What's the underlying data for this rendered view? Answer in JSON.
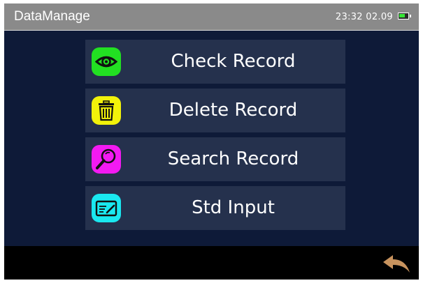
{
  "header": {
    "title": "DataManage",
    "datetime": "23:32  02.09",
    "battery_icon": "battery-icon"
  },
  "menu": [
    {
      "label": "Check Record",
      "icon": "eye-icon",
      "icon_bg": "#22e022"
    },
    {
      "label": "Delete Record",
      "icon": "trash-icon",
      "icon_bg": "#f2f20a"
    },
    {
      "label": "Search Record",
      "icon": "magnifier-icon",
      "icon_bg": "#f21af2"
    },
    {
      "label": "Std Input",
      "icon": "card-edit-icon",
      "icon_bg": "#1ae8f0"
    }
  ],
  "footer": {
    "back_icon": "back-arrow-icon"
  },
  "colors": {
    "screen_bg": "#0e1a38",
    "titlebar_bg": "#8a8a8a",
    "item_bg": "#25314d",
    "back_arrow": "#c8935e"
  }
}
